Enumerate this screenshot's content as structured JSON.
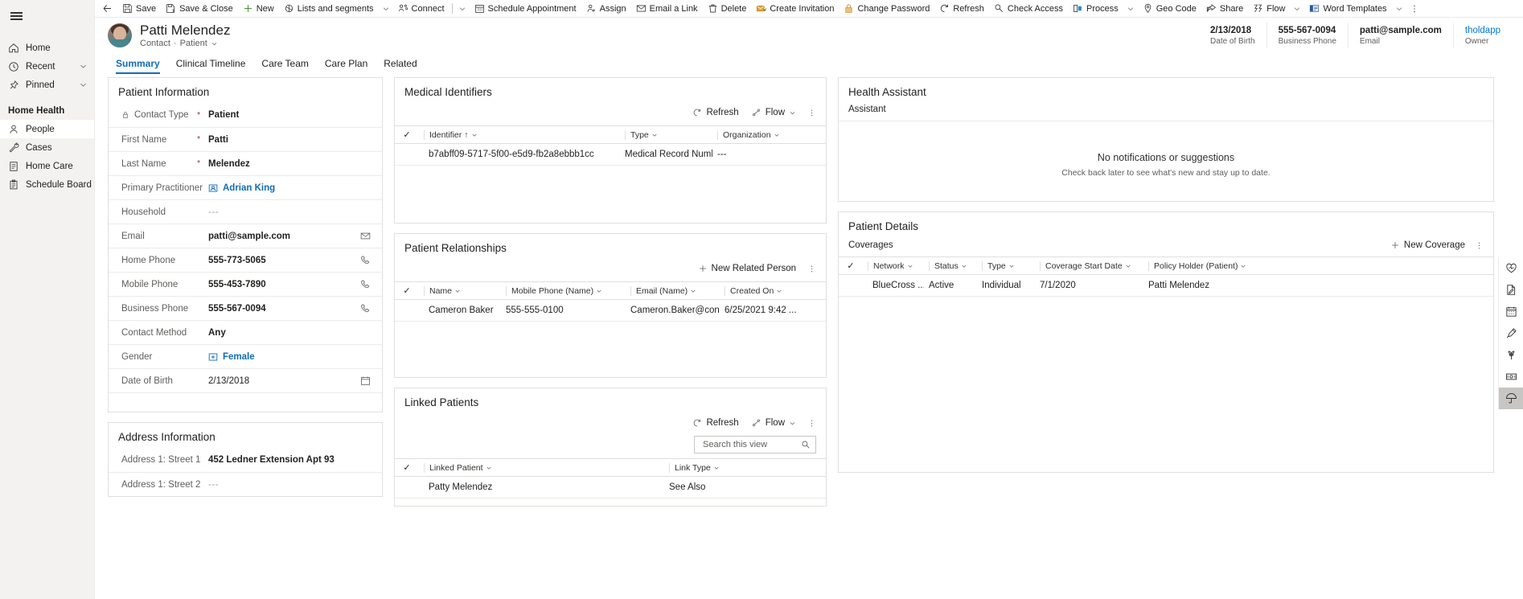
{
  "commandbar": {
    "back_label": "Back",
    "items": [
      {
        "label": "Save",
        "icon": "save-icon",
        "caret": false
      },
      {
        "label": "Save & Close",
        "icon": "save-close-icon",
        "caret": false
      },
      {
        "label": "New",
        "icon": "plus-icon",
        "caret": false
      },
      {
        "label": "Lists and segments",
        "icon": "lists-icon",
        "caret": true
      },
      {
        "label": "Connect",
        "icon": "connect-icon",
        "caret": true,
        "separator_before_caret": true
      },
      {
        "label": "Schedule Appointment",
        "icon": "calendar-icon",
        "caret": false
      },
      {
        "label": "Assign",
        "icon": "assign-user-icon",
        "caret": false
      },
      {
        "label": "Email a Link",
        "icon": "email-link-icon",
        "caret": false
      },
      {
        "label": "Delete",
        "icon": "trash-icon",
        "caret": false
      },
      {
        "label": "Create Invitation",
        "icon": "invitation-icon",
        "caret": false
      },
      {
        "label": "Change Password",
        "icon": "lock-icon",
        "caret": false
      },
      {
        "label": "Refresh",
        "icon": "refresh-icon",
        "caret": false
      },
      {
        "label": "Check Access",
        "icon": "key-icon",
        "caret": false
      },
      {
        "label": "Process",
        "icon": "process-icon",
        "caret": true
      },
      {
        "label": "Geo Code",
        "icon": "map-pin-icon",
        "caret": false
      },
      {
        "label": "Share",
        "icon": "share-icon",
        "caret": false
      },
      {
        "label": "Flow",
        "icon": "flow-icon",
        "caret": true
      },
      {
        "label": "Word Templates",
        "icon": "word-template-icon",
        "caret": true
      }
    ],
    "overflow_label": "More commands"
  },
  "sidebar": {
    "menu_label": "Site map",
    "items": [
      {
        "label": "Home",
        "icon": "home-icon",
        "chevron": false,
        "selected": false
      },
      {
        "label": "Recent",
        "icon": "clock-icon",
        "chevron": true,
        "selected": false
      },
      {
        "label": "Pinned",
        "icon": "pin-icon",
        "chevron": true,
        "selected": false
      }
    ],
    "section_title": "Home Health",
    "section_items": [
      {
        "label": "People",
        "icon": "person-icon",
        "selected": true
      },
      {
        "label": "Cases",
        "icon": "case-icon",
        "selected": false
      },
      {
        "label": "Home Care",
        "icon": "homecare-icon",
        "selected": false
      },
      {
        "label": "Schedule Board",
        "icon": "schedule-board-icon",
        "selected": false
      }
    ]
  },
  "record_header": {
    "title": "Patti Melendez",
    "entity": "Contact",
    "separator": "·",
    "record_type": "Patient",
    "fields": [
      {
        "value": "2/13/2018",
        "label": "Date of Birth",
        "link": false
      },
      {
        "value": "555-567-0094",
        "label": "Business Phone",
        "link": false
      },
      {
        "value": "patti@sample.com",
        "label": "Email",
        "link": false
      },
      {
        "value": "tholdapp",
        "label": "Owner",
        "link": true
      }
    ]
  },
  "tabs": [
    {
      "label": "Summary",
      "active": true
    },
    {
      "label": "Clinical Timeline",
      "active": false
    },
    {
      "label": "Care Team",
      "active": false
    },
    {
      "label": "Care Plan",
      "active": false
    },
    {
      "label": "Related",
      "active": false
    }
  ],
  "patient_information": {
    "title": "Patient Information",
    "rows": [
      {
        "label": "Contact Type",
        "value": "Patient",
        "required": true,
        "lock": true,
        "style": "bold",
        "trailing": ""
      },
      {
        "label": "First Name",
        "value": "Patti",
        "required": true,
        "lock": false,
        "style": "bold",
        "trailing": ""
      },
      {
        "label": "Last Name",
        "value": "Melendez",
        "required": true,
        "lock": false,
        "style": "bold",
        "trailing": ""
      },
      {
        "label": "Primary Practitioner",
        "value": "Adrian King",
        "required": false,
        "lock": false,
        "style": "link",
        "trailing": ""
      },
      {
        "label": "Household",
        "value": "---",
        "required": false,
        "lock": false,
        "style": "muted",
        "trailing": ""
      },
      {
        "label": "Email",
        "value": "patti@sample.com",
        "required": false,
        "lock": false,
        "style": "bold",
        "trailing": "email-icon"
      },
      {
        "label": "Home Phone",
        "value": "555-773-5065",
        "required": false,
        "lock": false,
        "style": "bold",
        "trailing": "phone-icon"
      },
      {
        "label": "Mobile Phone",
        "value": "555-453-7890",
        "required": false,
        "lock": false,
        "style": "bold",
        "trailing": "phone-icon"
      },
      {
        "label": "Business Phone",
        "value": "555-567-0094",
        "required": false,
        "lock": false,
        "style": "bold",
        "trailing": "phone-icon"
      },
      {
        "label": "Contact Method",
        "value": "Any",
        "required": false,
        "lock": false,
        "style": "bold",
        "trailing": ""
      },
      {
        "label": "Gender",
        "value": "Female",
        "required": false,
        "lock": false,
        "style": "link",
        "trailing": ""
      },
      {
        "label": "Date of Birth",
        "value": "2/13/2018",
        "required": false,
        "lock": false,
        "style": "plain",
        "trailing": "calendar-icon"
      }
    ]
  },
  "address_information": {
    "title": "Address Information",
    "rows": [
      {
        "label": "Address 1: Street 1",
        "value": "452 Ledner Extension Apt 93",
        "style": "bold"
      },
      {
        "label": "Address 1: Street 2",
        "value": "---",
        "style": "muted"
      }
    ]
  },
  "medical_identifiers": {
    "title": "Medical Identifiers",
    "toolbar": {
      "refresh": "Refresh",
      "flow": "Flow",
      "kebab": "More commands"
    },
    "columns": [
      "Identifier",
      "Type",
      "Organization"
    ],
    "sorted_column": "Identifier",
    "rows": [
      {
        "identifier": "b7abff09-5717-5f00-e5d9-fb2a8ebbb1cc",
        "type": "Medical Record Number",
        "organization": "---"
      }
    ]
  },
  "patient_relationships": {
    "title": "Patient Relationships",
    "toolbar": {
      "new": "New Related Person",
      "kebab": "More commands"
    },
    "columns": [
      "Name",
      "Mobile Phone (Name)",
      "Email (Name)",
      "Created On"
    ],
    "rows": [
      {
        "name": "Cameron Baker",
        "mobile_phone": "555-555-0100",
        "email": "Cameron.Baker@contoso.com",
        "created_on": "6/25/2021 9:42 ..."
      }
    ]
  },
  "linked_patients": {
    "title": "Linked Patients",
    "toolbar": {
      "refresh": "Refresh",
      "flow": "Flow",
      "kebab": "More commands"
    },
    "search_placeholder": "Search this view",
    "search_value": "",
    "columns": [
      "Linked Patient",
      "Link Type"
    ],
    "rows": [
      {
        "linked_patient": "Patty Melendez",
        "link_type": "See Also"
      }
    ]
  },
  "health_assistant": {
    "title": "Health Assistant",
    "tab_label": "Assistant",
    "empty_title": "No notifications or suggestions",
    "empty_subtitle": "Check back later to see what's new and stay up to date."
  },
  "patient_details": {
    "title": "Patient Details",
    "coverages_label": "Coverages",
    "new_coverage_label": "New Coverage",
    "kebab": "More commands",
    "columns": [
      "Network",
      "Status",
      "Type",
      "Coverage Start Date",
      "Policy Holder (Patient)"
    ],
    "rows": [
      {
        "network": "BlueCross ...",
        "status": "Active",
        "type": "Individual",
        "start_date": "7/1/2020",
        "policy_holder": "Patti Melendez"
      }
    ]
  },
  "right_rail": {
    "items": [
      {
        "icon": "heart-health-icon",
        "active": false
      },
      {
        "icon": "document-edit-icon",
        "active": false
      },
      {
        "icon": "calendar-icon",
        "active": false
      },
      {
        "icon": "syringe-icon",
        "active": false
      },
      {
        "icon": "allergy-icon",
        "active": false
      },
      {
        "icon": "payment-icon",
        "active": false
      },
      {
        "icon": "umbrella-coverage-icon",
        "active": true
      }
    ]
  },
  "colors": {
    "accent": "#0f6cbd",
    "link": "#0078d4",
    "required": "#a4262c",
    "nav_bg": "#f3f2f1",
    "border": "#e1dfdd"
  }
}
